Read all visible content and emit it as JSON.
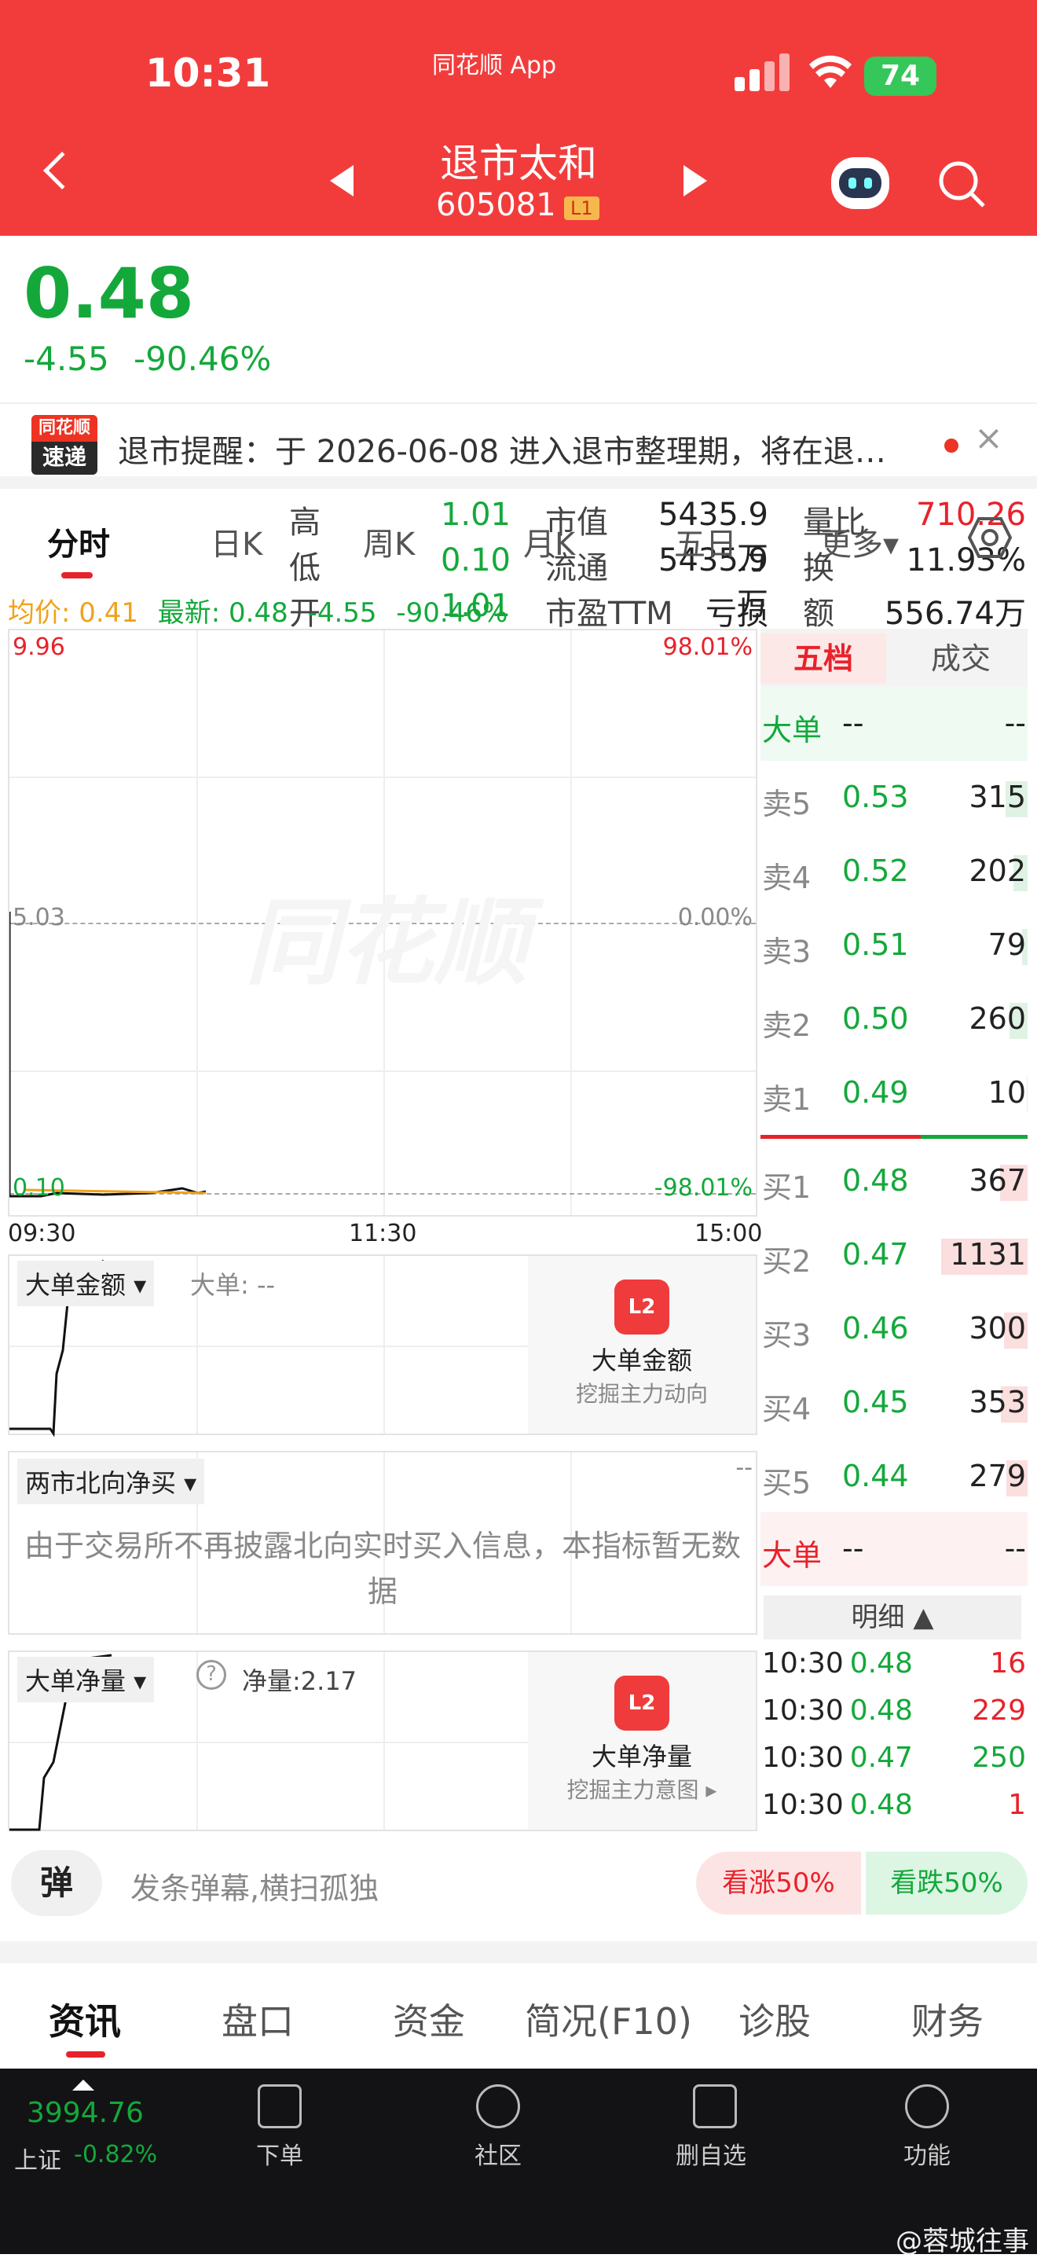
{
  "status": {
    "time": "10:31",
    "app": "同花顺 App",
    "battery": "74"
  },
  "nav": {
    "title": "退市太和",
    "code": "605081",
    "level": "L1"
  },
  "quote": {
    "price": "0.48",
    "change": "-4.55",
    "change_pct": "-90.46%",
    "rows": [
      {
        "l1": "高",
        "v1": "1.01",
        "l2": "市值",
        "v2": "5435.9万",
        "l3": "量比",
        "v3": "710.26"
      },
      {
        "l1": "低",
        "v1": "0.10",
        "l2": "流通",
        "v2": "5435.9万",
        "l3": "换",
        "v3": "11.93%"
      },
      {
        "l1": "开",
        "v1": "1.01",
        "l2": "市盈TTM",
        "v2": "亏损",
        "l3": "额",
        "v3": "556.74万"
      }
    ]
  },
  "notice": {
    "badge_top": "同花顺",
    "badge_bottom": "速递",
    "text": "退市提醒：于 2026-06-08 进入退市整理期，将在退…"
  },
  "chart_tabs": [
    "分时",
    "日K",
    "周K",
    "月K",
    "五日",
    "更多▾"
  ],
  "summary": {
    "avg_label": "均价: 0.41",
    "latest_label": "最新: 0.48",
    "chg": "-4.55",
    "pct": "-90.46%"
  },
  "chart_data": {
    "type": "line",
    "x": [
      "09:30",
      "11:30",
      "15:00"
    ],
    "y_left": [
      "9.96",
      "5.03",
      "0.10"
    ],
    "y_right": [
      "98.01%",
      "0.00%",
      "-98.01%"
    ],
    "series": [
      {
        "values": [
          5.03,
          0.1,
          0.1,
          0.35,
          0.36,
          0.38,
          0.4,
          0.42,
          0.48
        ]
      }
    ]
  },
  "orderbook": {
    "tabs": [
      "五档",
      "成交"
    ],
    "big_label": "大单",
    "big_val": "--",
    "big_val2": "--",
    "sell": [
      {
        "l": "卖5",
        "p": "0.53",
        "v": "315"
      },
      {
        "l": "卖4",
        "p": "0.52",
        "v": "202"
      },
      {
        "l": "卖3",
        "p": "0.51",
        "v": "79"
      },
      {
        "l": "卖2",
        "p": "0.50",
        "v": "260"
      },
      {
        "l": "卖1",
        "p": "0.49",
        "v": "10"
      }
    ],
    "buy": [
      {
        "l": "买1",
        "p": "0.48",
        "v": "367"
      },
      {
        "l": "买2",
        "p": "0.47",
        "v": "1131"
      },
      {
        "l": "买3",
        "p": "0.46",
        "v": "300"
      },
      {
        "l": "买4",
        "p": "0.45",
        "v": "353"
      },
      {
        "l": "买5",
        "p": "0.44",
        "v": "279"
      }
    ],
    "detail_label": "明细 ▲",
    "trades": [
      {
        "t": "10:30",
        "p": "0.48",
        "v": "16"
      },
      {
        "t": "10:30",
        "p": "0.48",
        "v": "229"
      },
      {
        "t": "10:30",
        "p": "0.47",
        "v": "250"
      },
      {
        "t": "10:30",
        "p": "0.48",
        "v": "1"
      }
    ]
  },
  "ind1": {
    "select": "大单金额 ▾",
    "val": "大单: --",
    "ad_title": "大单金额",
    "ad_sub": "挖掘主力动向"
  },
  "ind2": {
    "select": "两市北向净买 ▾",
    "dash": "--",
    "msg": "由于交易所不再披露北向实时买入信息，本指标暂无数据"
  },
  "ind3": {
    "select": "大单净量 ▾",
    "val": "净量:2.17",
    "ad_title": "大单净量",
    "ad_sub": "挖掘主力意图 ▸"
  },
  "danmu": {
    "btn": "弹",
    "placeholder": "发条弹幕,横扫孤独",
    "up": "看涨50%",
    "down": "看跌50%"
  },
  "bottom_tabs": [
    "资讯",
    "盘口",
    "资金",
    "简况(F10)",
    "诊股",
    "财务"
  ],
  "tabbar": {
    "index_val": "3994.76",
    "index_name": "上证",
    "index_pct": "-0.82%",
    "items": [
      "下单",
      "社区",
      "删自选",
      "功能"
    ]
  },
  "watermark": "@蓉城往事"
}
